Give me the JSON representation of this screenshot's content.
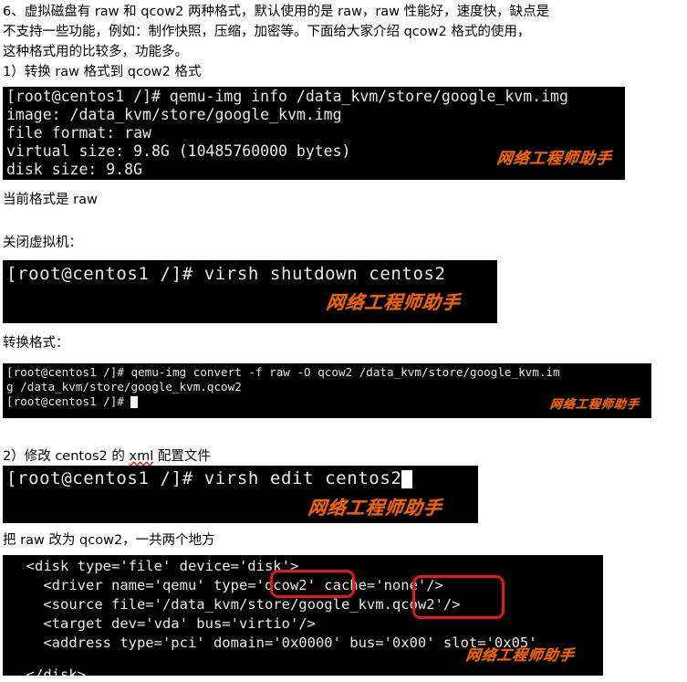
{
  "document": {
    "paragraphs": [
      {
        "id": "intro-line-1",
        "text": "6、虚拟磁盘有 raw 和 qcow2 两种格式，默认使用的是 raw，raw 性能好，速度快，缺点是"
      },
      {
        "id": "intro-line-2",
        "text": "不支持一些功能，例如：制作快照，压缩，加密等。下面给大家介绍 qcow2 格式的使用，"
      },
      {
        "id": "intro-line-3",
        "text": "这种格式用的比较多，功能多。"
      },
      {
        "id": "step-1-heading",
        "text": "1）转换 raw 格式到 qcow2 格式"
      },
      {
        "id": "caption-current-format",
        "text": "当前格式是 raw"
      },
      {
        "id": "caption-shutdown-vm",
        "text": "关闭虚拟机："
      },
      {
        "id": "caption-convert-format",
        "text": "转换格式："
      },
      {
        "id": "step-2-heading-part1",
        "text": "2）修改 centos2 的 "
      },
      {
        "id": "step-2-heading-misspelled",
        "text": "xml"
      },
      {
        "id": "step-2-heading-part2",
        "text": " 配置文件"
      },
      {
        "id": "caption-change-raw-to-qcow2",
        "text": "把 raw 改为 qcow2，一共两个地方"
      }
    ],
    "watermark_text": "网络工程师助手",
    "watermark_color": "#e8640a",
    "terminal_background": "#000000",
    "terminal_foreground": "#e8e8e8",
    "annotation_color": "#e01b1b"
  },
  "terminals": {
    "qemu_img_info": {
      "id": "terminal-qemu-img-info",
      "lines": [
        "[root@centos1 /]# qemu-img info /data_kvm/store/google_kvm.img",
        "image: /data_kvm/store/google_kvm.img",
        "file format: raw",
        "virtual size: 9.8G (10485760000 bytes)",
        "disk size: 9.8G"
      ]
    },
    "virsh_shutdown": {
      "id": "terminal-virsh-shutdown",
      "lines": [
        "[root@centos1 /]# virsh shutdown centos2"
      ]
    },
    "qemu_img_convert": {
      "id": "terminal-qemu-img-convert",
      "lines": [
        "[root@centos1 /]# qemu-img convert -f raw -O qcow2 /data_kvm/store/google_kvm.im",
        "g /data_kvm/store/google_kvm.qcow2",
        "[root@centos1 /]# "
      ],
      "has_cursor_on_last_line": true
    },
    "virsh_edit": {
      "id": "terminal-virsh-edit",
      "lines": [
        "[root@centos1 /]# virsh edit centos2"
      ],
      "has_cursor_on_last_line": true
    },
    "xml_disk_config": {
      "id": "terminal-xml-disk-config",
      "lines": [
        "  <disk type='file' device='disk'>",
        "    <driver name='qemu' type='qcow2' cache='none'/>",
        "    <source file='/data_kvm/store/google_kvm.qcow2'/>",
        "    <target dev='vda' bus='virtio'/>",
        "    <address type='pci' domain='0x0000' bus='0x00' slot='0x05'",
        "  </disk>"
      ],
      "annotations": [
        {
          "id": "annotation-driver-type-qcow2",
          "label": "qcow2"
        },
        {
          "id": "annotation-source-file-qcow2",
          "label": "qcow2"
        }
      ]
    }
  }
}
